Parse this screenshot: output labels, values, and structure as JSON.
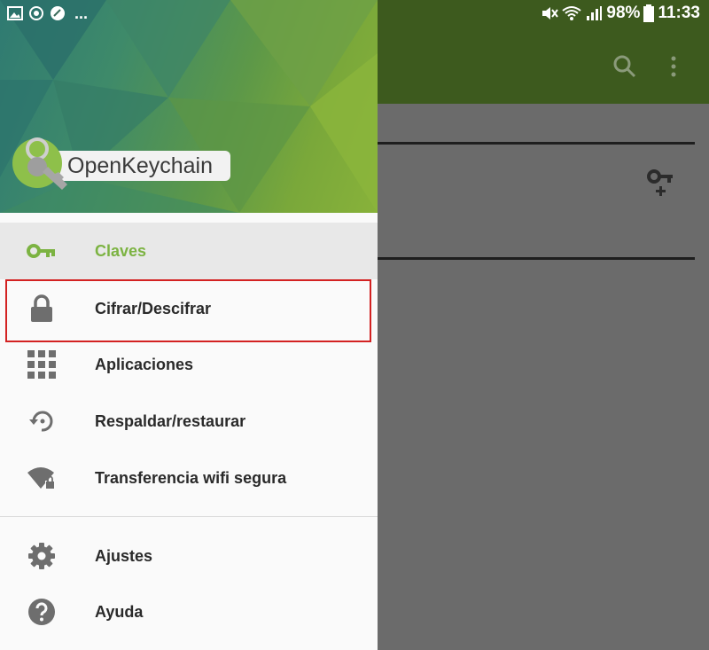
{
  "status_bar": {
    "battery": "98%",
    "time": "11:33",
    "overflow": "..."
  },
  "drawer": {
    "logo_text": "OpenKeychain",
    "items": [
      {
        "label": "Claves",
        "icon": "key-icon",
        "active": true
      },
      {
        "label": "Cifrar/Descifrar",
        "icon": "lock-icon",
        "active": false
      },
      {
        "label": "Aplicaciones",
        "icon": "apps-grid-icon",
        "active": false
      },
      {
        "label": "Respaldar/restaurar",
        "icon": "restore-icon",
        "active": false
      },
      {
        "label": "Transferencia wifi segura",
        "icon": "wifi-lock-icon",
        "active": false
      }
    ],
    "secondary_items": [
      {
        "label": "Ajustes",
        "icon": "gear-icon"
      },
      {
        "label": "Ayuda",
        "icon": "help-icon"
      }
    ]
  },
  "colors": {
    "accent": "#7cb342",
    "toolbar": "#3d5a1e",
    "highlight": "#d32222"
  }
}
